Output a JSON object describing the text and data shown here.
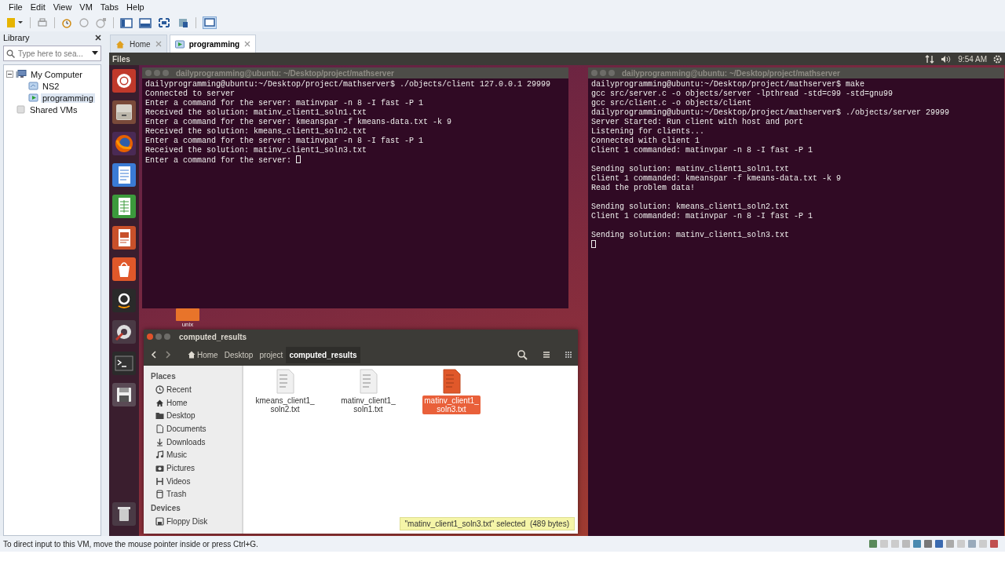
{
  "menu": [
    "File",
    "Edit",
    "View",
    "VM",
    "Tabs",
    "Help"
  ],
  "library": {
    "title": "Library",
    "search": {
      "placeholder": "Type here to sea..."
    },
    "tree": [
      {
        "label": "My Computer",
        "kind": "computer",
        "expanded": true,
        "selected": false,
        "children": [
          {
            "label": "NS2",
            "kind": "vm",
            "selected": false
          },
          {
            "label": "programming",
            "kind": "vm-running",
            "selected": true
          }
        ]
      },
      {
        "label": "Shared VMs",
        "kind": "shared",
        "selected": false
      }
    ]
  },
  "tabs": [
    {
      "label": "Home",
      "selected": false
    },
    {
      "label": "programming",
      "selected": true
    }
  ],
  "top_panel": {
    "app": "Files",
    "time": "9:54 AM"
  },
  "terminals": [
    {
      "title": "dailyprogramming@ubuntu: ~/Desktop/project/mathserver",
      "lines": [
        {
          "kind": "text",
          "text": "dailyprogramming@ubuntu:~/Desktop/project/mathserver$ ./objects/client 127.0.0.1 29999"
        },
        {
          "kind": "text",
          "text": "Connected to server"
        },
        {
          "kind": "text",
          "text": "Enter a command for the server: matinvpar -n 8 -I fast -P 1"
        },
        {
          "kind": "text",
          "text": "Received the solution: matinv_client1_soln1.txt"
        },
        {
          "kind": "text",
          "text": "Enter a command for the server: kmeanspar -f kmeans-data.txt -k 9"
        },
        {
          "kind": "text",
          "text": "Received the solution: kmeans_client1_soln2.txt"
        },
        {
          "kind": "text",
          "text": "Enter a command for the server: matinvpar -n 8 -I fast -P 1"
        },
        {
          "kind": "text",
          "text": "Received the solution: matinv_client1_soln3.txt"
        },
        {
          "kind": "prompt",
          "text": "Enter a command for the server: "
        }
      ]
    },
    {
      "title": "dailyprogramming@ubuntu: ~/Desktop/project/mathserver",
      "lines": [
        {
          "kind": "text",
          "text": "dailyprogramming@ubuntu:~/Desktop/project/mathserver$ make"
        },
        {
          "kind": "text",
          "text": "gcc src/server.c -o objects/server -lpthread -std=c99 -std=gnu99"
        },
        {
          "kind": "text",
          "text": "gcc src/client.c -o objects/client"
        },
        {
          "kind": "text",
          "text": "dailyprogramming@ubuntu:~/Desktop/project/mathserver$ ./objects/server 29999"
        },
        {
          "kind": "text",
          "text": "Server Started: Run client with host and port"
        },
        {
          "kind": "text",
          "text": "Listening for clients..."
        },
        {
          "kind": "text",
          "text": "Connected with client 1"
        },
        {
          "kind": "text",
          "text": "Client 1 commanded: matinvpar -n 8 -I fast -P 1"
        },
        {
          "kind": "blank"
        },
        {
          "kind": "text",
          "text": "Sending solution: matinv_client1_soln1.txt"
        },
        {
          "kind": "text",
          "text": "Client 1 commanded: kmeanspar -f kmeans-data.txt -k 9"
        },
        {
          "kind": "text",
          "text": "Read the problem data!"
        },
        {
          "kind": "blank"
        },
        {
          "kind": "text",
          "text": "Sending solution: kmeans_client1_soln2.txt"
        },
        {
          "kind": "text",
          "text": "Client 1 commanded: matinvpar -n 8 -I fast -P 1"
        },
        {
          "kind": "blank"
        },
        {
          "kind": "text",
          "text": "Sending solution: matinv_client1_soln3.txt"
        },
        {
          "kind": "prompt"
        }
      ]
    }
  ],
  "desktop_icon": {
    "label": "unix"
  },
  "file_manager": {
    "title": "computed_results",
    "breadcrumbs": [
      {
        "label": "Home",
        "kind": "home",
        "selected": false
      },
      {
        "label": "Desktop",
        "kind": "plain",
        "selected": false
      },
      {
        "label": "project",
        "kind": "plain",
        "selected": false
      },
      {
        "label": "computed_results",
        "kind": "plain",
        "selected": true
      }
    ],
    "sidebar": [
      {
        "heading": "Places",
        "items": [
          {
            "label": "Recent",
            "kind": "recent"
          },
          {
            "label": "Home",
            "kind": "home"
          },
          {
            "label": "Desktop",
            "kind": "folder"
          },
          {
            "label": "Documents",
            "kind": "document"
          },
          {
            "label": "Downloads",
            "kind": "download"
          },
          {
            "label": "Music",
            "kind": "music"
          },
          {
            "label": "Pictures",
            "kind": "camera"
          },
          {
            "label": "Videos",
            "kind": "film"
          },
          {
            "label": "Trash",
            "kind": "trash"
          }
        ]
      },
      {
        "heading": "Devices",
        "items": [
          {
            "label": "Floppy Disk",
            "kind": "floppy"
          }
        ]
      }
    ],
    "files": [
      {
        "name": "kmeans_client1_soln2.txt",
        "selected": false
      },
      {
        "name": "matinv_client1_soln1.txt",
        "selected": false
      },
      {
        "name": "matinv_client1_soln3.txt",
        "selected": true
      }
    ],
    "status": "\"matinv_client1_soln3.txt\" selected  (489 bytes)"
  },
  "status_bar": "To direct input to this VM, move the mouse pointer inside or press Ctrl+G."
}
